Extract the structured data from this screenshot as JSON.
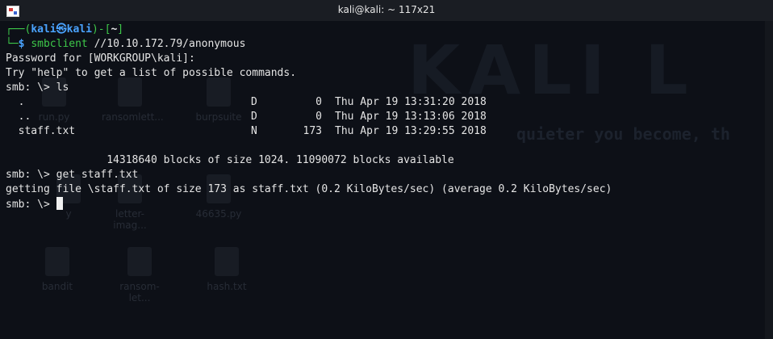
{
  "window": {
    "title": "kali@kali: ~ 117x21"
  },
  "prompt": {
    "open": "┌──(",
    "user": "kali",
    "at": "㉿",
    "host": "kali",
    "mid": ")-[",
    "dir": "~",
    "close": "]",
    "second": "└─",
    "dollar": "$ ",
    "command_name": "smbclient",
    "command_args": " //10.10.172.79/anonymous"
  },
  "output": {
    "password": "Password for [WORKGROUP\\kali]:",
    "help": "Try \"help\" to get a list of possible commands.",
    "smb_prompt": "smb: \\> ",
    "cmd_ls": "ls",
    "listing": [
      {
        "name": "  .",
        "type": "D",
        "size": "0",
        "date": "Thu Apr 19 13:31:20 2018"
      },
      {
        "name": "  ..",
        "type": "D",
        "size": "0",
        "date": "Thu Apr 19 13:13:06 2018"
      },
      {
        "name": "  staff.txt",
        "type": "N",
        "size": "173",
        "date": "Thu Apr 19 13:29:55 2018"
      }
    ],
    "blocks": "                14318640 blocks of size 1024. 11090072 blocks available",
    "cmd_get": "get staff.txt",
    "getting": "getting file \\staff.txt of size 173 as staff.txt (0.2 KiloBytes/sec) (average 0.2 KiloBytes/sec)"
  },
  "wallpaper": {
    "logo_text": "KALI L",
    "slogan": "quieter you become, th",
    "icons": [
      "run.py",
      "ransomlett...",
      "burpsuite",
      "y",
      "letter-imag...",
      "46635.py",
      "bandit",
      "ransom-let...",
      "hash.txt"
    ]
  }
}
